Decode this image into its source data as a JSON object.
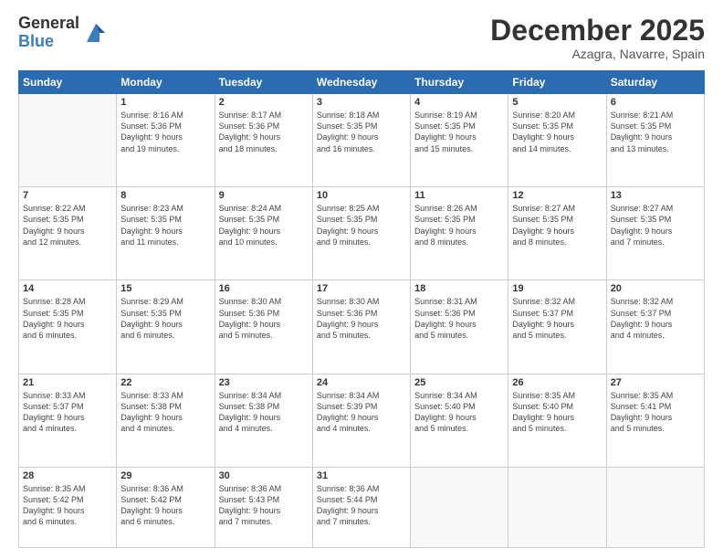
{
  "logo": {
    "general": "General",
    "blue": "Blue"
  },
  "header": {
    "month": "December 2025",
    "location": "Azagra, Navarre, Spain"
  },
  "weekdays": [
    "Sunday",
    "Monday",
    "Tuesday",
    "Wednesday",
    "Thursday",
    "Friday",
    "Saturday"
  ],
  "weeks": [
    [
      {
        "day": "",
        "info": ""
      },
      {
        "day": "1",
        "info": "Sunrise: 8:16 AM\nSunset: 5:36 PM\nDaylight: 9 hours\nand 19 minutes."
      },
      {
        "day": "2",
        "info": "Sunrise: 8:17 AM\nSunset: 5:36 PM\nDaylight: 9 hours\nand 18 minutes."
      },
      {
        "day": "3",
        "info": "Sunrise: 8:18 AM\nSunset: 5:35 PM\nDaylight: 9 hours\nand 16 minutes."
      },
      {
        "day": "4",
        "info": "Sunrise: 8:19 AM\nSunset: 5:35 PM\nDaylight: 9 hours\nand 15 minutes."
      },
      {
        "day": "5",
        "info": "Sunrise: 8:20 AM\nSunset: 5:35 PM\nDaylight: 9 hours\nand 14 minutes."
      },
      {
        "day": "6",
        "info": "Sunrise: 8:21 AM\nSunset: 5:35 PM\nDaylight: 9 hours\nand 13 minutes."
      }
    ],
    [
      {
        "day": "7",
        "info": "Sunrise: 8:22 AM\nSunset: 5:35 PM\nDaylight: 9 hours\nand 12 minutes."
      },
      {
        "day": "8",
        "info": "Sunrise: 8:23 AM\nSunset: 5:35 PM\nDaylight: 9 hours\nand 11 minutes."
      },
      {
        "day": "9",
        "info": "Sunrise: 8:24 AM\nSunset: 5:35 PM\nDaylight: 9 hours\nand 10 minutes."
      },
      {
        "day": "10",
        "info": "Sunrise: 8:25 AM\nSunset: 5:35 PM\nDaylight: 9 hours\nand 9 minutes."
      },
      {
        "day": "11",
        "info": "Sunrise: 8:26 AM\nSunset: 5:35 PM\nDaylight: 9 hours\nand 8 minutes."
      },
      {
        "day": "12",
        "info": "Sunrise: 8:27 AM\nSunset: 5:35 PM\nDaylight: 9 hours\nand 8 minutes."
      },
      {
        "day": "13",
        "info": "Sunrise: 8:27 AM\nSunset: 5:35 PM\nDaylight: 9 hours\nand 7 minutes."
      }
    ],
    [
      {
        "day": "14",
        "info": "Sunrise: 8:28 AM\nSunset: 5:35 PM\nDaylight: 9 hours\nand 6 minutes."
      },
      {
        "day": "15",
        "info": "Sunrise: 8:29 AM\nSunset: 5:35 PM\nDaylight: 9 hours\nand 6 minutes."
      },
      {
        "day": "16",
        "info": "Sunrise: 8:30 AM\nSunset: 5:36 PM\nDaylight: 9 hours\nand 5 minutes."
      },
      {
        "day": "17",
        "info": "Sunrise: 8:30 AM\nSunset: 5:36 PM\nDaylight: 9 hours\nand 5 minutes."
      },
      {
        "day": "18",
        "info": "Sunrise: 8:31 AM\nSunset: 5:36 PM\nDaylight: 9 hours\nand 5 minutes."
      },
      {
        "day": "19",
        "info": "Sunrise: 8:32 AM\nSunset: 5:37 PM\nDaylight: 9 hours\nand 5 minutes."
      },
      {
        "day": "20",
        "info": "Sunrise: 8:32 AM\nSunset: 5:37 PM\nDaylight: 9 hours\nand 4 minutes."
      }
    ],
    [
      {
        "day": "21",
        "info": "Sunrise: 8:33 AM\nSunset: 5:37 PM\nDaylight: 9 hours\nand 4 minutes."
      },
      {
        "day": "22",
        "info": "Sunrise: 8:33 AM\nSunset: 5:38 PM\nDaylight: 9 hours\nand 4 minutes."
      },
      {
        "day": "23",
        "info": "Sunrise: 8:34 AM\nSunset: 5:38 PM\nDaylight: 9 hours\nand 4 minutes."
      },
      {
        "day": "24",
        "info": "Sunrise: 8:34 AM\nSunset: 5:39 PM\nDaylight: 9 hours\nand 4 minutes."
      },
      {
        "day": "25",
        "info": "Sunrise: 8:34 AM\nSunset: 5:40 PM\nDaylight: 9 hours\nand 5 minutes."
      },
      {
        "day": "26",
        "info": "Sunrise: 8:35 AM\nSunset: 5:40 PM\nDaylight: 9 hours\nand 5 minutes."
      },
      {
        "day": "27",
        "info": "Sunrise: 8:35 AM\nSunset: 5:41 PM\nDaylight: 9 hours\nand 5 minutes."
      }
    ],
    [
      {
        "day": "28",
        "info": "Sunrise: 8:35 AM\nSunset: 5:42 PM\nDaylight: 9 hours\nand 6 minutes."
      },
      {
        "day": "29",
        "info": "Sunrise: 8:36 AM\nSunset: 5:42 PM\nDaylight: 9 hours\nand 6 minutes."
      },
      {
        "day": "30",
        "info": "Sunrise: 8:36 AM\nSunset: 5:43 PM\nDaylight: 9 hours\nand 7 minutes."
      },
      {
        "day": "31",
        "info": "Sunrise: 8:36 AM\nSunset: 5:44 PM\nDaylight: 9 hours\nand 7 minutes."
      },
      {
        "day": "",
        "info": ""
      },
      {
        "day": "",
        "info": ""
      },
      {
        "day": "",
        "info": ""
      }
    ]
  ]
}
